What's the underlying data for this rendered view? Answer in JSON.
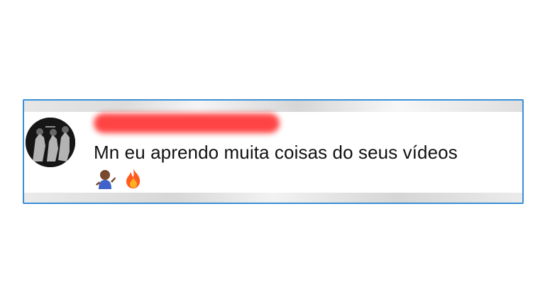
{
  "comment": {
    "text": "Mn eu aprendo muita coisas do seus vídeos",
    "emojis": [
      "woman-tipping-hand-icon",
      "fire-icon"
    ]
  },
  "colors": {
    "border": "#3a8fd8",
    "redaction": "#ff3b3b",
    "text": "#111111"
  }
}
